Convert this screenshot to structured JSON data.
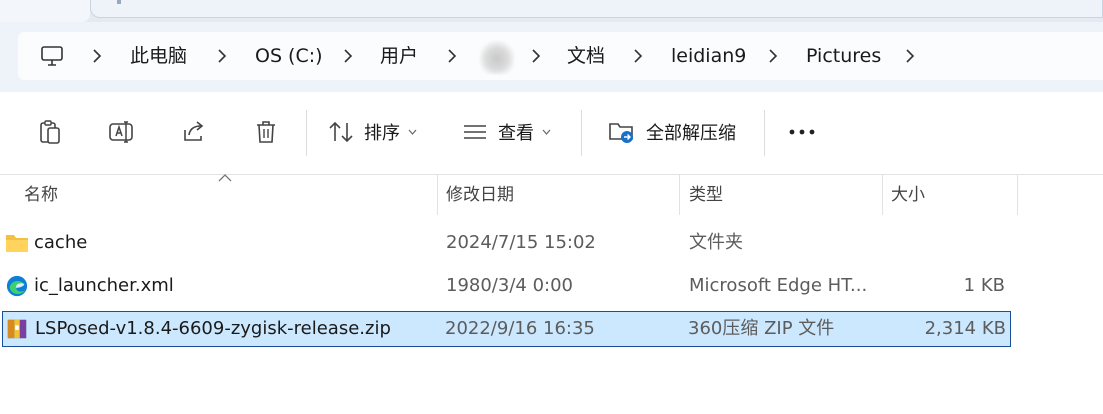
{
  "address": {
    "segments": [
      "此电脑",
      "OS (C:)",
      "用户",
      "",
      "文档",
      "leidian9",
      "Pictures"
    ],
    "icon": "computer-icon"
  },
  "toolbar": {
    "copy_icon": "clipboard-icon",
    "rename_icon": "rename-icon",
    "share_icon": "share-icon",
    "delete_icon": "trash-icon",
    "sort_label": "排序",
    "view_label": "查看",
    "extract_label": "全部解压缩",
    "more_icon": "more-icon"
  },
  "columns": {
    "name": "名称",
    "date": "修改日期",
    "type": "类型",
    "size": "大小"
  },
  "files": [
    {
      "name": "cache",
      "date": "2024/7/15 15:02",
      "type": "文件夹",
      "size": "",
      "icon": "folder-icon",
      "selected": false
    },
    {
      "name": "ic_launcher.xml",
      "date": "1980/3/4 0:00",
      "type": "Microsoft Edge HT...",
      "size": "1 KB",
      "icon": "edge-icon",
      "selected": false
    },
    {
      "name": "LSPosed-v1.8.4-6609-zygisk-release.zip",
      "date": "2022/9/16 16:35",
      "type": "360压缩 ZIP 文件",
      "size": "2,314 KB",
      "icon": "zip-icon",
      "selected": true
    }
  ],
  "colors": {
    "selection_bg": "#cce8ff",
    "selection_border": "#1b4f99",
    "navbar_bg": "#eef3f9"
  }
}
